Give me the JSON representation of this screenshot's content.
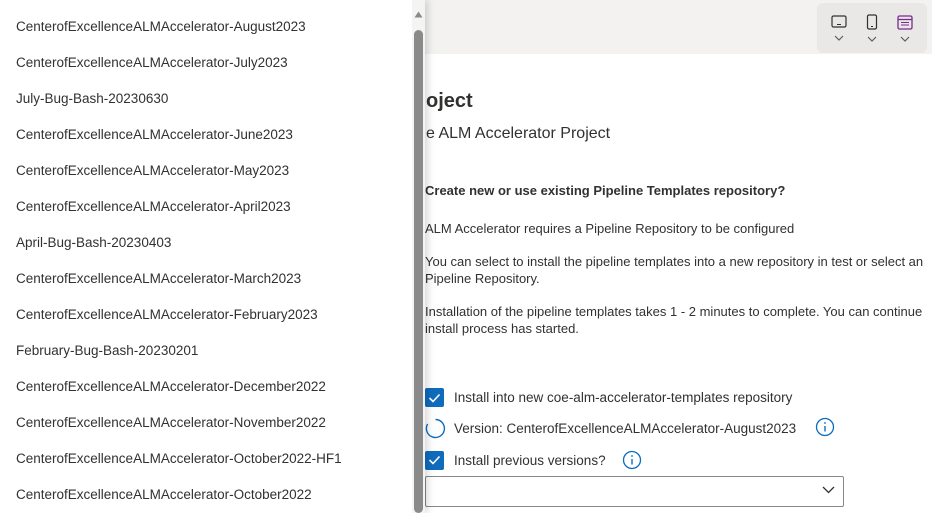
{
  "panel": {
    "title": "oject",
    "subtitle": "e ALM Accelerator Project",
    "section_heading": "Create new or use existing Pipeline Templates repository?",
    "paragraphs": [
      "ALM Accelerator requires a Pipeline Repository to be configured",
      "You can select to install the pipeline templates into a new repository in test or select an Pipeline Repository.",
      "Installation of the pipeline templates takes 1 - 2 minutes to complete. You can continue install process has started."
    ],
    "install_new_label": "Install into new coe-alm-accelerator-templates repository",
    "version_label": "Version: CenterofExcellenceALMAccelerator-August2023",
    "install_previous_label": "Install previous versions?",
    "combo_value": ""
  },
  "dropdown": {
    "items": [
      "CenterofExcellenceALMAccelerator-August2023",
      "CenterofExcellenceALMAccelerator-July2023",
      "July-Bug-Bash-20230630",
      "CenterofExcellenceALMAccelerator-June2023",
      "CenterofExcellenceALMAccelerator-May2023",
      "CenterofExcellenceALMAccelerator-April2023",
      "April-Bug-Bash-20230403",
      "CenterofExcellenceALMAccelerator-March2023",
      "CenterofExcellenceALMAccelerator-February2023",
      "February-Bug-Bash-20230201",
      "CenterofExcellenceALMAccelerator-December2022",
      "CenterofExcellenceALMAccelerator-November2022",
      "CenterofExcellenceALMAccelerator-October2022-HF1",
      "CenterofExcellenceALMAccelerator-October2022"
    ]
  },
  "colors": {
    "accent": "#0f6cbd",
    "device_active": "#7a2b8f"
  },
  "icons": {
    "device_toolbar": [
      "tablet-icon",
      "phone-icon",
      "web-icon"
    ],
    "version_status": "spinner-icon",
    "info": "info-icon"
  }
}
